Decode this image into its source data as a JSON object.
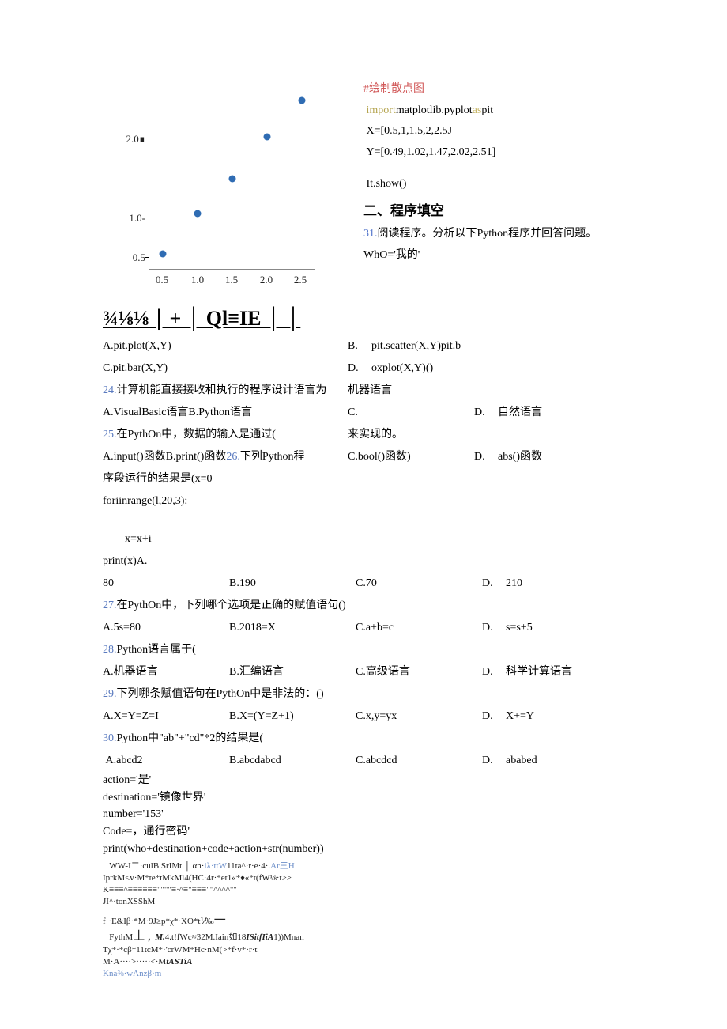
{
  "chart_data": {
    "type": "scatter",
    "x": [
      0.5,
      1.0,
      1.5,
      2.0,
      2.5
    ],
    "y": [
      0.49,
      1.02,
      1.47,
      2.02,
      2.51
    ],
    "xticks": [
      "0.5",
      "1.0",
      "1.5",
      "2.0",
      "2.5"
    ],
    "yticks": [
      "0.5",
      "1.0-",
      "2.0∎"
    ],
    "xlim": [
      0.3,
      2.7
    ],
    "ylim": [
      0.3,
      2.7
    ]
  },
  "code": {
    "comment": "#绘制散点图",
    "import_kw": "import",
    "import_mid": "matplotlib.pyplot",
    "as_kw": "as",
    "import_alias": "pit",
    "x_line": "X=[0.5,1,1.5,2,2.5J",
    "y_line": "Y=[0.49,1.02,1.47,2.02,2.51]",
    "show": "It.show()"
  },
  "section2_title": "二、程序填空",
  "q31_prefix": "31.",
  "q31_text": "阅读程序。分析以下Python程序并回答问题。",
  "q31_line1": "WhO='我的'",
  "bigline": "¾⅛⅛ ∣ + │ Ql≡IE │ │",
  "q23": {
    "a": "A.pit.plot(X,Y)",
    "b_label": "B.",
    "b": "pit.scatter(X,Y)pit.b",
    "c": "C.pit.bar(X,Y)",
    "d_label": "D.",
    "d": "oxplot(X,Y)()"
  },
  "q24": {
    "num": "24.",
    "stem": "计算机能直接接收和执行的程序设计语言为",
    "stem_right": "机器语言",
    "a": "A.VisualBasic语言B.Python语言",
    "c_label": "C.",
    "d_label": "D.",
    "d": "自然语言"
  },
  "q25": {
    "num": "25.",
    "stem": "在PythOn中，数据的输入是通过(",
    "stem_right": "来实现的。",
    "a": "A.input()函数B.print()函数",
    "line26num": "26.",
    "line26text": "下列Python程",
    "c": "C.bool()函数)",
    "d_label": "D.",
    "d": "abs()函数",
    "cont1": "序段运行的结果是(x=0",
    "cont2": "foriinrange(l,20,3):",
    "cont3": "x=x+i",
    "cont4": "print(x)A.",
    "cont5": "80"
  },
  "q26opts": {
    "b": "B.190",
    "c": "C.70",
    "d_label": "D.",
    "d": "210"
  },
  "q27": {
    "num": "27.",
    "stem": "在PythOn中，下列哪个选项是正确的赋值语句()",
    "a": "A.5s=80",
    "b": "B.2018=X",
    "c": "C.a+b=c",
    "d_label": "D.",
    "d": "s=s+5"
  },
  "q28": {
    "num": "28.",
    "stem": "Python语言属于(",
    "a": "A.机器语言",
    "b": "B.汇编语言",
    "c": "C.高级语言",
    "d_label": "D.",
    "d": "科学计算语言"
  },
  "q29": {
    "num": "29.",
    "stem": "下列哪条赋值语句在PythOn中是非法的：()",
    "a": "A.X=Y=Z=I",
    "b": "B.X=(Y=Z+1)",
    "c": "C.x,y=yx",
    "d_label": "D.",
    "d": "X+=Y"
  },
  "q30": {
    "num": "30.",
    "stem": "Python中\"ab\"+\"cd\"*2的结果是(",
    "a": "A.abcd2",
    "b": "B.abcdabcd",
    "c": "C.abcdcd",
    "d_label": "D.",
    "d": "ababed"
  },
  "tail": {
    "l1": "action='是'",
    "l2": "destination='镜像世界'",
    "l3": "number='153'",
    "l4": "Code=，通行密码'",
    "l5": "print(who+destination+code+action+str(number))"
  },
  "garble": {
    "l1a": "WW-I二·culB.SrIMt │ αn·",
    "l1b": "iλ·ttW",
    "l1c": "11ta^·r·e·4·.",
    "l1d": "Ar三H",
    "l2": "IprkM<v·M*te*tMkMl4(HC·4r·*et1«*♦«*t(fW⅛·t>>",
    "l3": "K≡≡≡^≡≡≡≡≡≡\"\"\"\"≡·^≡\"≡≡≡\"\"^^^^\"\"",
    "l4": "JI^·tonXSShM",
    "l5a": "f··E&Iβ·*",
    "l5b": "M·9J≥p*χ*·XO*t⅟‰",
    "l5c": "一",
    "l6a": "FythM",
    "l6b": "丄      ,",
    "l6c": "M.",
    "l6d": "4.t!fWc≈32M.Iain如18",
    "l6e": "ISitfIiA",
    "l6f": "1))Mnan",
    "l7": "Tχ*·*cβ*11tcM*·'crWM*Hc·nM(>*f·v*·r·t",
    "l8a": "M·A····>·····<·M",
    "l8b": "tASTiA",
    "l9": "Kna⅜·wAnzβ·m"
  }
}
